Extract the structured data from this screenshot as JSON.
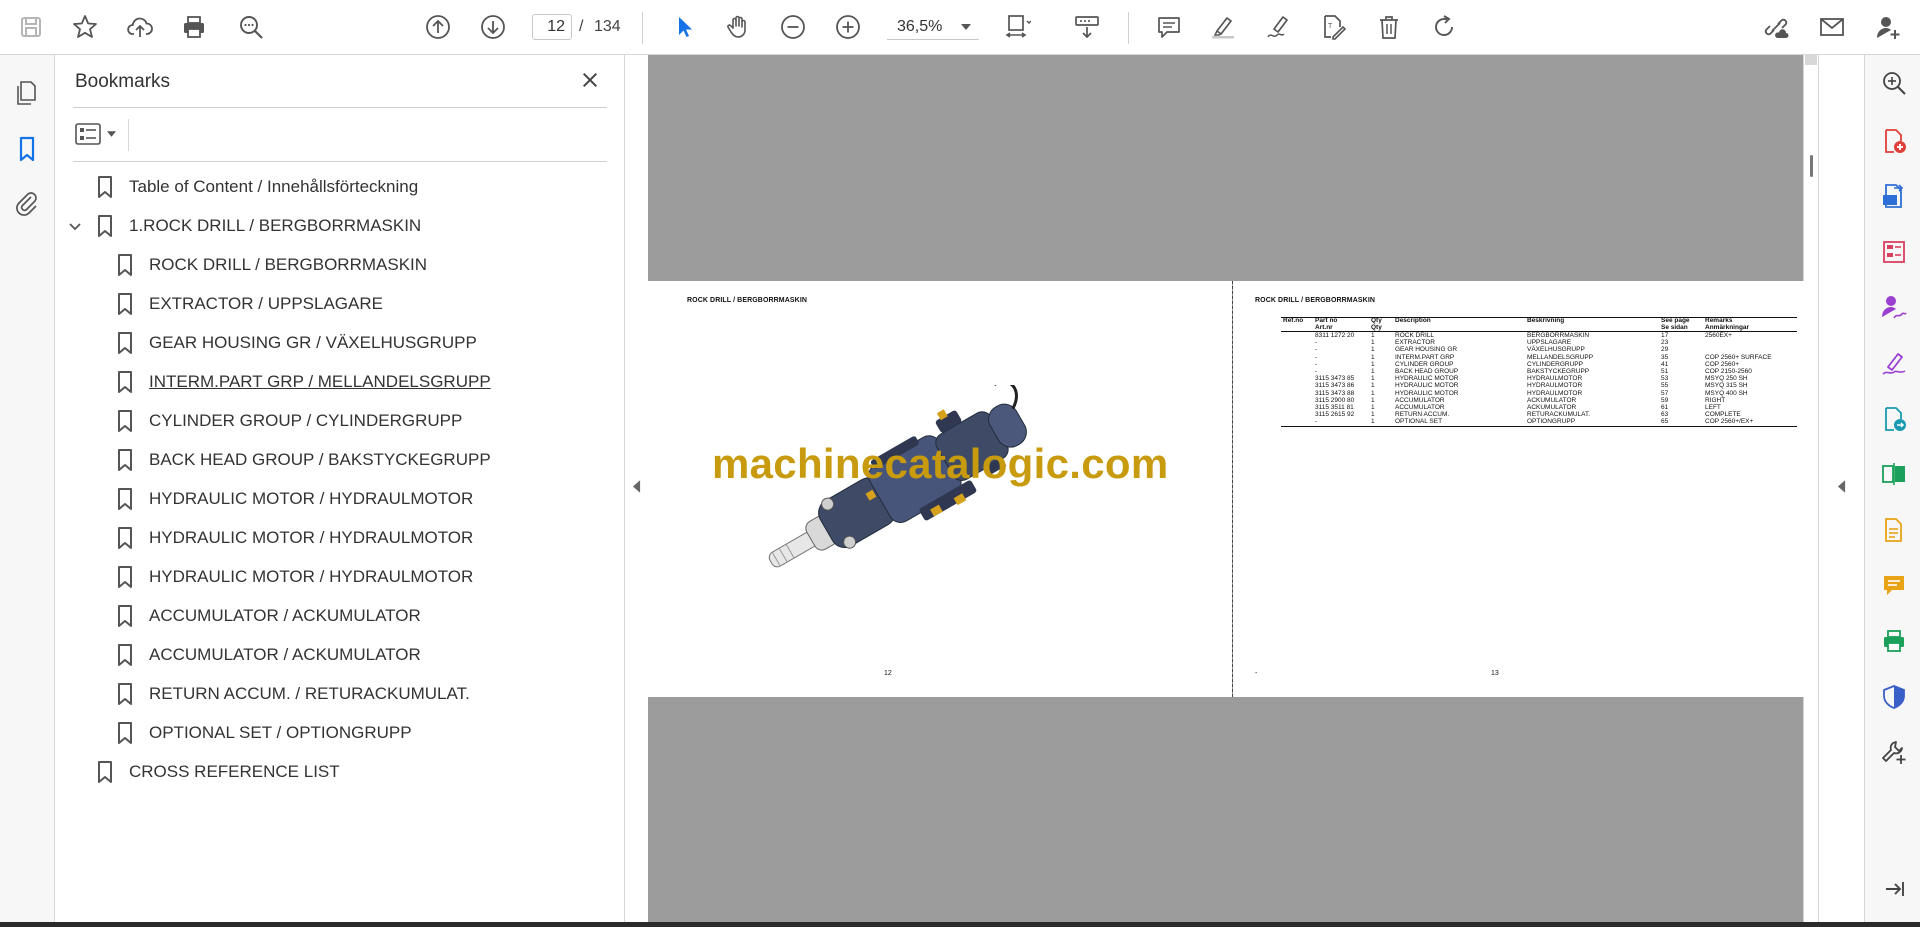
{
  "toolbar": {
    "page_current": "12",
    "page_separator": "/",
    "page_total": "134",
    "zoom": "36,5%"
  },
  "bookmarks": {
    "title": "Bookmarks",
    "items": [
      {
        "label": "Table of Content / Innehållsförteckning"
      },
      {
        "label": "1.ROCK DRILL / BERGBORRMASKIN"
      },
      {
        "label": "ROCK DRILL / BERGBORRMASKIN"
      },
      {
        "label": "EXTRACTOR / UPPSLAGARE"
      },
      {
        "label": "GEAR HOUSING GR / VÄXELHUSGRUPP"
      },
      {
        "label": "INTERM.PART GRP / MELLANDELSGRUPP"
      },
      {
        "label": "CYLINDER GROUP / CYLINDERGRUPP"
      },
      {
        "label": "BACK HEAD GROUP / BAKSTYCKEGRUPP"
      },
      {
        "label": "HYDRAULIC MOTOR / HYDRAULMOTOR"
      },
      {
        "label": "HYDRAULIC MOTOR / HYDRAULMOTOR"
      },
      {
        "label": "HYDRAULIC MOTOR / HYDRAULMOTOR"
      },
      {
        "label": "ACCUMULATOR / ACKUMULATOR"
      },
      {
        "label": "ACCUMULATOR / ACKUMULATOR"
      },
      {
        "label": "RETURN ACCUM. / RETURACKUMULAT."
      },
      {
        "label": "OPTIONAL SET / OPTIONGRUPP"
      },
      {
        "label": "CROSS REFERENCE LIST"
      }
    ]
  },
  "document": {
    "left_page": {
      "title": "ROCK DRILL / BERGBORRMASKIN",
      "page_number": "12"
    },
    "right_page": {
      "title": "ROCK DRILL / BERGBORRMASKIN",
      "page_number": "13",
      "footer_left": "-",
      "headers": [
        [
          "Ref.no",
          ""
        ],
        [
          "Part no",
          "Art.nr"
        ],
        [
          "Qty",
          "Qty"
        ],
        [
          "Description",
          ""
        ],
        [
          "Beskrivning",
          ""
        ],
        [
          "See page",
          "Se sidan"
        ],
        [
          "Remarks",
          "Anmärkningar"
        ]
      ],
      "rows": [
        [
          "",
          "8311 1272 20",
          "1",
          "ROCK DRILL",
          "BERGBORRMASKIN",
          "17",
          "2560EX+"
        ],
        [
          "",
          "-",
          "1",
          "EXTRACTOR",
          "UPPSLAGARE",
          "23",
          ""
        ],
        [
          "",
          "-",
          "1",
          "GEAR HOUSING GR",
          "VÄXELHUSGRUPP",
          "29",
          ""
        ],
        [
          "",
          "-",
          "1",
          "INTERM.PART GRP",
          "MELLANDELSGRUPP",
          "35",
          "COP 2560+ SURFACE"
        ],
        [
          "",
          "-",
          "1",
          "CYLINDER GROUP",
          "CYLINDERGRUPP",
          "41",
          "COP 2560+"
        ],
        [
          "",
          "-",
          "1",
          "BACK HEAD GROUP",
          "BAKSTYCKEGRUPP",
          "51",
          "COP 2150-2560"
        ],
        [
          "",
          "3115 3473 85",
          "1",
          "HYDRAULIC MOTOR",
          "HYDRAULMOTOR",
          "53",
          "MSYQ 250 SH"
        ],
        [
          "",
          "3115 3473 86",
          "1",
          "HYDRAULIC MOTOR",
          "HYDRAULMOTOR",
          "55",
          "MSYQ 315 SH"
        ],
        [
          "",
          "3115 3473 88",
          "1",
          "HYDRAULIC MOTOR",
          "HYDRAULMOTOR",
          "57",
          "MSYQ 400 SH"
        ],
        [
          "",
          "3115 2900 80",
          "1",
          "ACCUMULATOR",
          "ACKUMULATOR",
          "59",
          "RIGHT"
        ],
        [
          "",
          "3115 3511 81",
          "1",
          "ACCUMULATOR",
          "ACKUMULATOR",
          "61",
          "LEFT"
        ],
        [
          "",
          "3115 2615 92",
          "1",
          "RETURN ACCUM.",
          "RETURACKUMULAT.",
          "63",
          "COMPLETE"
        ],
        [
          "",
          "-",
          "1",
          "OPTIONAL SET",
          "OPTIONGRUPP",
          "65",
          "COP 2560+/EX+"
        ]
      ]
    },
    "watermark": "machinecatalogic.com"
  },
  "colors": {
    "accent": "#1473e6",
    "watermark": "#c89a0e",
    "purple_tools": "#9b3fd1",
    "drill_body": "#3e4a66"
  }
}
